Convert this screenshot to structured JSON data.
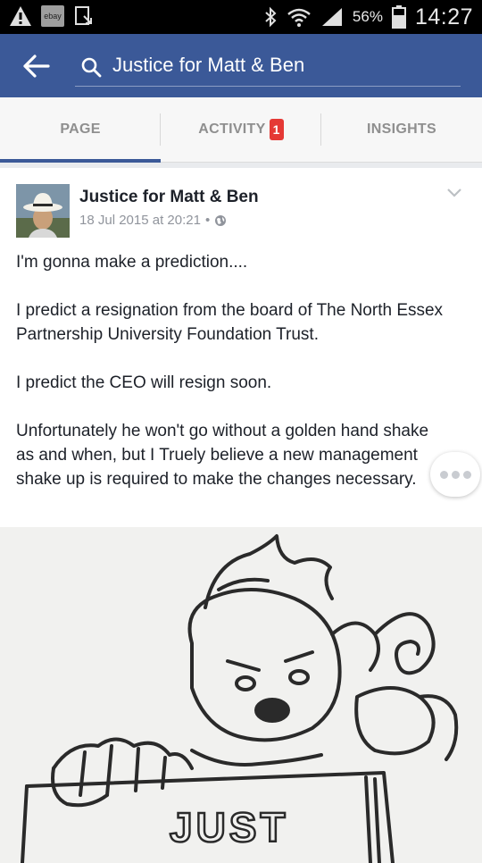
{
  "status_bar": {
    "battery_percent": "56%",
    "time": "14:27",
    "left_icons": [
      "warning-icon",
      "ebay-icon",
      "download-icon"
    ],
    "right_icons": [
      "bluetooth-icon",
      "wifi-icon",
      "signal-icon",
      "battery-icon"
    ],
    "ebay_label": "ebay"
  },
  "header": {
    "search_text": "Justice for Matt & Ben",
    "color": "#3b5998"
  },
  "tabs": [
    {
      "label": "PAGE",
      "active": true
    },
    {
      "label": "ACTIVITY",
      "badge": "1"
    },
    {
      "label": "INSIGHTS"
    }
  ],
  "post": {
    "author": "Justice for Matt & Ben",
    "timestamp": "18 Jul 2015 at 20:21",
    "separator": "•",
    "paragraphs": [
      "I'm gonna make a prediction....",
      "I predict a resignation from the board of The North Essex Partnership University Foundation Trust.",
      "I predict the CEO will resign soon.",
      "Unfortunately he won't go without a golden hand shake as and when,  but I Truely believe a new management shake up is required to make the changes necessary."
    ],
    "image_sign_text": "JUST"
  }
}
